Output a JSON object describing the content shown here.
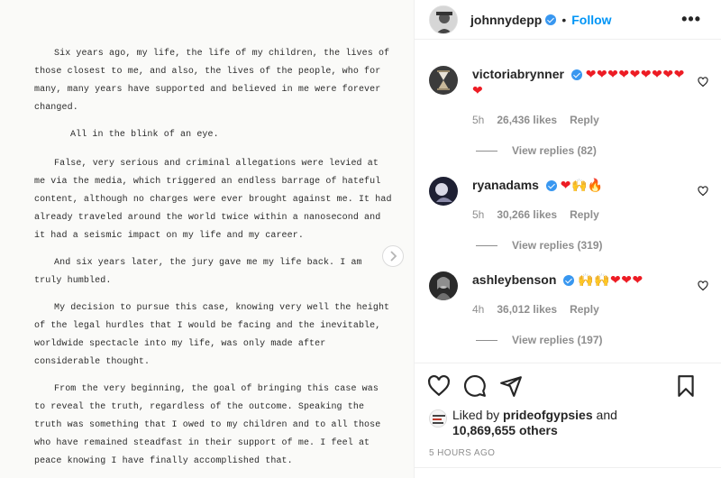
{
  "post": {
    "letter": {
      "p1": "Six years ago, my life, the life of my children, the lives of those closest to me, and also, the lives of the people, who for many, many years have supported and believed in me were forever changed.",
      "p2": "All in the blink of an eye.",
      "p3": "False, very serious and criminal allegations were levied at me via the media, which triggered an endless barrage of hateful content, although no charges were ever brought against me. It had already traveled around the world twice within a nanosecond and it had a seismic impact on my life and my career.",
      "p4": "And six years later, the jury gave me my life back. I am truly humbled.",
      "p5": "My decision to pursue this case, knowing very well the height of the legal hurdles that I would be facing and the inevitable, worldwide spectacle into my life, was only made after considerable thought.",
      "p6": "From the very beginning, the goal of bringing this case was to reveal the truth, regardless of the outcome. Speaking the truth was something that I owed to my children and to all those who have remained steadfast in their support of me. I feel at peace knowing I have finally accomplished that."
    }
  },
  "header": {
    "username": "johnnydepp",
    "dot": "•",
    "follow_label": "Follow",
    "more": "•••"
  },
  "comments": [
    {
      "username": "victoriabrynner",
      "text": "❤❤❤❤❤❤❤❤❤❤",
      "time": "5h",
      "likes": "26,436 likes",
      "reply_label": "Reply",
      "view_replies": "View replies (82)"
    },
    {
      "username": "ryanadams",
      "text": "❤🙌🔥",
      "time": "5h",
      "likes": "30,266 likes",
      "reply_label": "Reply",
      "view_replies": "View replies (319)"
    },
    {
      "username": "ashleybenson",
      "text": "🙌🙌❤❤❤",
      "time": "4h",
      "likes": "36,012 likes",
      "reply_label": "Reply",
      "view_replies": "View replies (197)"
    }
  ],
  "likes": {
    "prefix": "Liked by",
    "user": "prideofgypsies",
    "and": "and",
    "others": "10,869,655 others"
  },
  "timestamp": "5 HOURS AGO",
  "colors": {
    "accent": "#0095f6",
    "verified": "#3897f0",
    "muted": "#8e8e8e",
    "text": "#262626"
  },
  "icons": [
    "chevron-right-icon",
    "heart-icon",
    "comment-icon",
    "share-icon",
    "bookmark-icon",
    "verified-icon"
  ]
}
